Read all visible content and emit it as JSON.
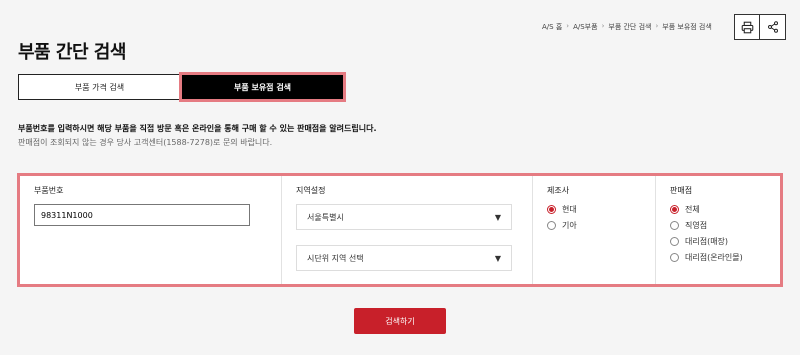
{
  "breadcrumb": {
    "items": [
      "A/S 홈",
      "A/S부품",
      "부품 간단 검색",
      "부품 보유점 검색"
    ],
    "separator": "›"
  },
  "toolbar": {
    "print_icon": "printer-icon",
    "share_icon": "share-icon"
  },
  "page": {
    "title": "부품 간단 검색"
  },
  "tabs": [
    {
      "label": "부품 가격 검색",
      "active": false
    },
    {
      "label": "부품 보유점 검색",
      "active": true
    }
  ],
  "info": {
    "line1": "부품번호를 입력하시면 해당 부품을 직접 방문 혹은 온라인을 통해 구매 할 수 있는 판매점을 알려드립니다.",
    "line2": "판매점이 조회되지 않는 경우 당사 고객센터(1588-7278)로 문의 바랍니다."
  },
  "form": {
    "part": {
      "label": "부품번호",
      "value": "98311N1000"
    },
    "region": {
      "label": "지역설정",
      "city": "서울특별시",
      "district_placeholder": "시단위 지역 선택"
    },
    "maker": {
      "label": "제조사",
      "options": [
        {
          "label": "현대",
          "checked": true
        },
        {
          "label": "기아",
          "checked": false
        }
      ]
    },
    "dealer": {
      "label": "판매점",
      "options": [
        {
          "label": "전체",
          "checked": true
        },
        {
          "label": "직영점",
          "checked": false
        },
        {
          "label": "대리점(매장)",
          "checked": false
        },
        {
          "label": "대리점(온라인몰)",
          "checked": false
        }
      ]
    }
  },
  "actions": {
    "search_label": "검색하기"
  },
  "colors": {
    "accent": "#c8202a",
    "highlight": "#e57b82"
  }
}
